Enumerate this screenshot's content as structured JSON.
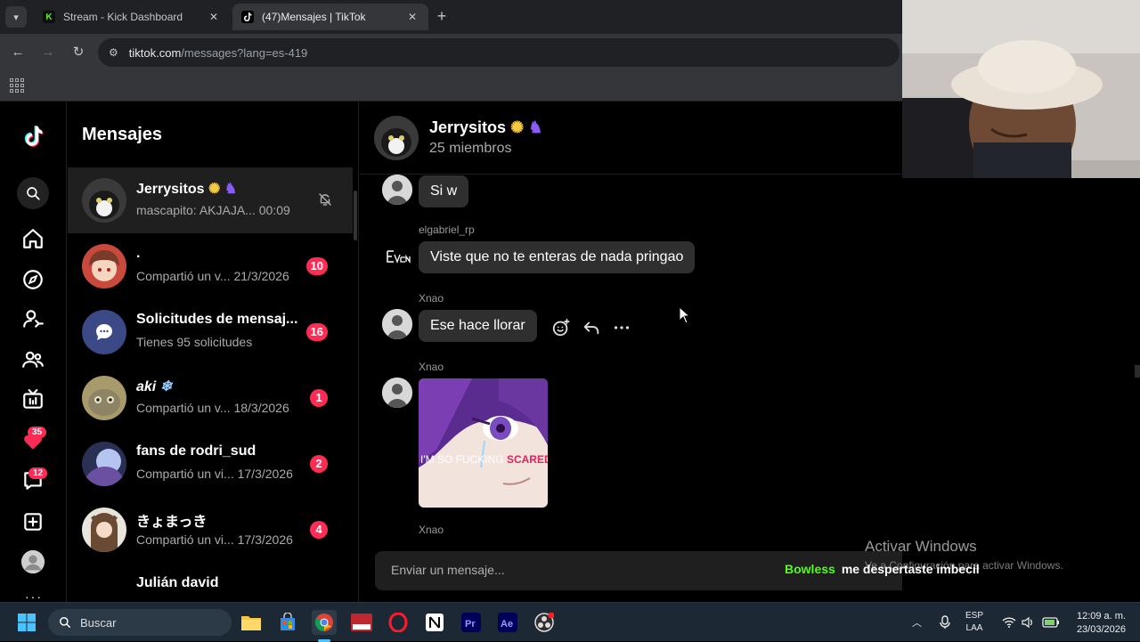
{
  "browser": {
    "tabs": [
      {
        "title": "Stream - Kick Dashboard",
        "active": false,
        "favicon": "kick-icon"
      },
      {
        "title": "(47)Mensajes | TikTok",
        "active": true,
        "favicon": "tiktok-icon"
      }
    ],
    "url_host": "tiktok.com",
    "url_path": "/messages?lang=es-419"
  },
  "nav": {
    "badges": {
      "inbox": "35",
      "messages": "12"
    }
  },
  "conversations": {
    "title": "Mensajes",
    "items": [
      {
        "name": "Jerrysitos",
        "preview": "mascapito: AKJAJA...",
        "time": "00:09",
        "count": "",
        "muted": true
      },
      {
        "name": ".",
        "preview": "Compartió un v...",
        "time": "21/3/2026",
        "count": "10"
      },
      {
        "name": "Solicitudes de mensaj...",
        "preview": "Tienes 95 solicitudes",
        "time": "",
        "count": "16"
      },
      {
        "name": "aki",
        "preview": "Compartió un v...",
        "time": "18/3/2026",
        "count": "1"
      },
      {
        "name": "fans de rodri_sud",
        "preview": "Compartió un vi...",
        "time": "17/3/2026",
        "count": "2"
      },
      {
        "name": "きょまっき",
        "preview": "Compartió un vi...",
        "time": "17/3/2026",
        "count": "4"
      },
      {
        "name": "Julián david",
        "preview": "",
        "time": "",
        "count": ""
      }
    ]
  },
  "chat": {
    "group_name": "Jerrysitos",
    "members": "25 miembros",
    "messages": [
      {
        "user": "",
        "text": "Si w"
      },
      {
        "user": "elgabriel_rp",
        "text": "Viste que no te enteras de nada pringao"
      },
      {
        "user": "Xnao",
        "text": "Ese hace llorar"
      },
      {
        "user": "Xnao",
        "text": "I'M SO FUCKING SCARED"
      },
      {
        "user": "Xnao",
        "text": ""
      }
    ],
    "input_placeholder": "Enviar un mensaje..."
  },
  "overlay": {
    "alert_user": "Bowless",
    "alert_text": "me despertaste imbecil",
    "activate_title": "Activar Windows",
    "activate_sub": "Ve a Configuración para activar Windows."
  },
  "taskbar": {
    "search": "Buscar",
    "lang_1": "ESP",
    "lang_2": "LAA",
    "time": "12:09 a. m.",
    "date": "23/03/2026"
  }
}
